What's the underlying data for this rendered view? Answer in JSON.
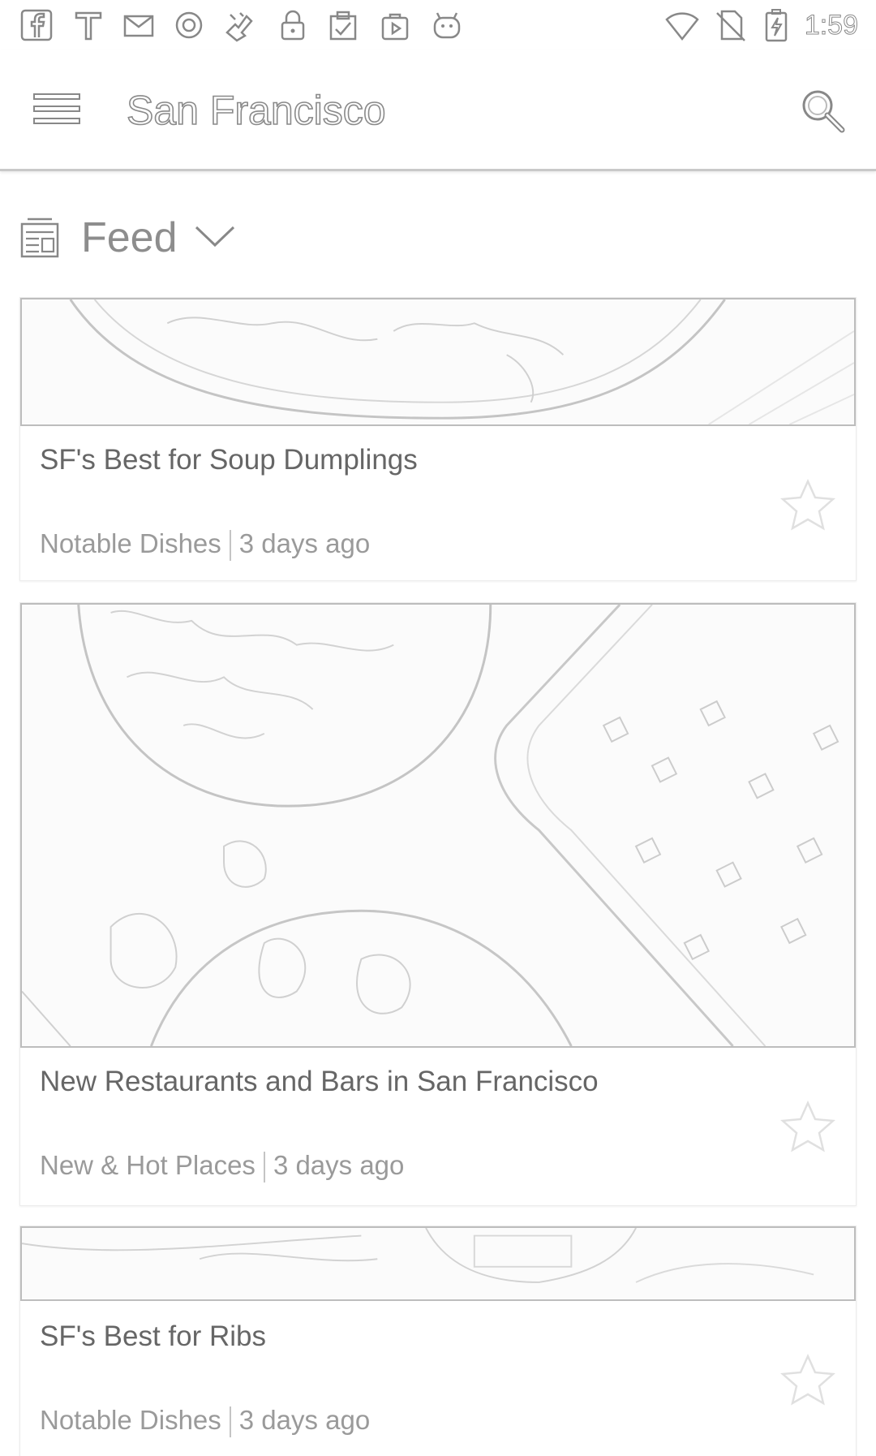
{
  "status_bar": {
    "time": "1:59",
    "icons": [
      "facebook-icon",
      "t-app-icon",
      "mail-icon",
      "circle-app-icon",
      "puzzle-icon",
      "lock-icon",
      "clipboard-check-icon",
      "play-store-icon",
      "android-icon",
      "wifi-icon",
      "no-sim-icon",
      "battery-charging-icon"
    ]
  },
  "app_bar": {
    "title": "San Francisco",
    "menu_icon": "hamburger-menu-icon",
    "search_icon": "search-icon"
  },
  "feed_header": {
    "label": "Feed",
    "icon": "newspaper-icon",
    "dropdown_icon": "chevron-down-icon"
  },
  "cards": [
    {
      "title": "SF's Best for Soup Dumplings",
      "category": "Notable Dishes",
      "time": "3 days ago"
    },
    {
      "title": "New Restaurants and Bars in San Francisco",
      "category": "New & Hot Places",
      "time": "3 days ago"
    },
    {
      "title": "SF's Best for Ribs",
      "category": "Notable Dishes",
      "time": "3 days ago"
    }
  ]
}
